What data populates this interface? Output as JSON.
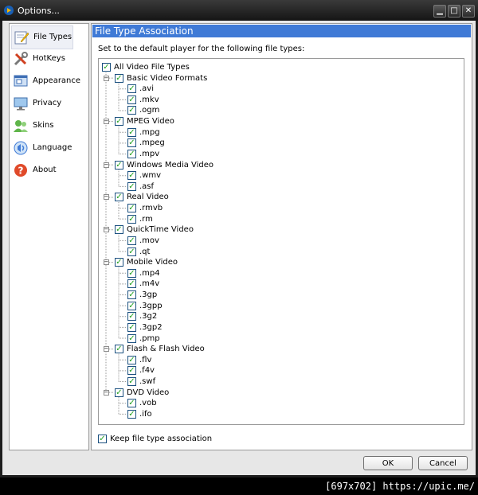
{
  "window": {
    "title": "Options..."
  },
  "sidebar": {
    "items": [
      {
        "label": "File Types",
        "icon": "file-types-icon",
        "selected": true
      },
      {
        "label": "HotKeys",
        "icon": "hotkeys-icon",
        "selected": false
      },
      {
        "label": "Appearance",
        "icon": "appearance-icon",
        "selected": false
      },
      {
        "label": "Privacy",
        "icon": "privacy-icon",
        "selected": false
      },
      {
        "label": "Skins",
        "icon": "skins-icon",
        "selected": false
      },
      {
        "label": "Language",
        "icon": "language-icon",
        "selected": false
      },
      {
        "label": "About",
        "icon": "about-icon",
        "selected": false
      }
    ]
  },
  "panel": {
    "title": "File Type Association",
    "description": "Set to the default player for the following file types:",
    "root": {
      "label": "All Video File Types",
      "checked": true
    },
    "groups": [
      {
        "label": "Basic Video Formats",
        "checked": true,
        "items": [
          ".avi",
          ".mkv",
          ".ogm"
        ]
      },
      {
        "label": "MPEG Video",
        "checked": true,
        "items": [
          ".mpg",
          ".mpeg",
          ".mpv"
        ]
      },
      {
        "label": "Windows Media Video",
        "checked": true,
        "items": [
          ".wmv",
          ".asf"
        ]
      },
      {
        "label": "Real Video",
        "checked": true,
        "items": [
          ".rmvb",
          ".rm"
        ]
      },
      {
        "label": "QuickTime Video",
        "checked": true,
        "items": [
          ".mov",
          ".qt"
        ]
      },
      {
        "label": "Mobile Video",
        "checked": true,
        "items": [
          ".mp4",
          ".m4v",
          ".3gp",
          ".3gpp",
          ".3g2",
          ".3gp2",
          ".pmp"
        ]
      },
      {
        "label": "Flash & Flash Video",
        "checked": true,
        "items": [
          ".flv",
          ".f4v",
          ".swf"
        ]
      },
      {
        "label": "DVD Video",
        "checked": true,
        "items": [
          ".vob",
          ".ifo"
        ]
      }
    ],
    "keep_label": "Keep file type association",
    "keep_checked": true
  },
  "buttons": {
    "ok": "OK",
    "cancel": "Cancel"
  },
  "statusbar": {
    "text": "[697x702] https://upic.me/"
  },
  "colors": {
    "header": "#3f7ad6",
    "check": "#21a121",
    "checkbox_border": "#1c5180"
  }
}
